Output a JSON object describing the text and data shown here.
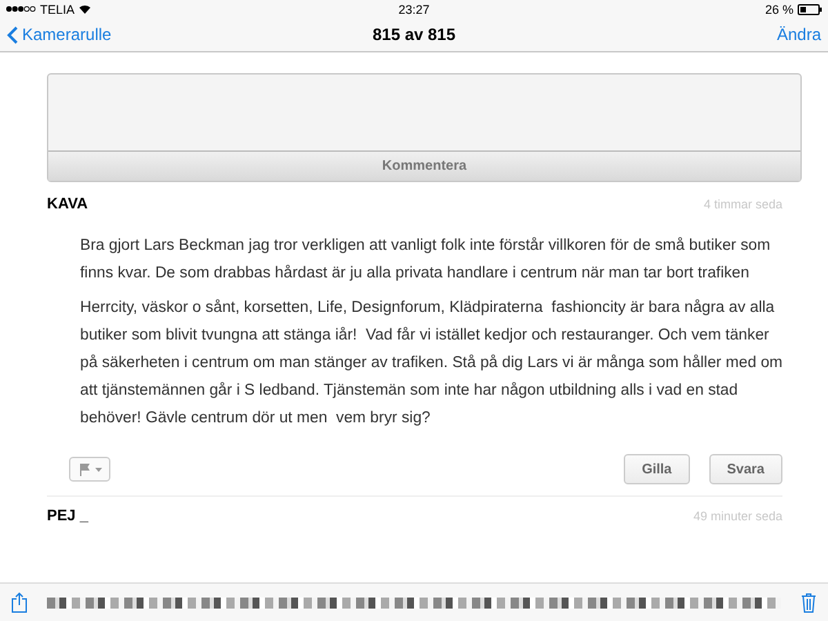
{
  "status_bar": {
    "carrier": "TELIA",
    "time": "23:27",
    "battery": "26 %"
  },
  "nav_bar": {
    "back": "Kamerarulle",
    "title": "815 av 815",
    "action": "Ändra"
  },
  "comment_box": {
    "button": "Kommentera"
  },
  "comments": [
    {
      "author": "KAVA",
      "time": "4 timmar seda",
      "paragraphs": [
        "Bra gjort Lars Beckman jag tror verkligen att vanligt folk inte förstår villkoren för de små butiker som finns kvar. De som drabbas hårdast är ju alla privata handlare i centrum när man tar bort trafiken",
        "Herrcity, väskor o sånt, korsetten, Life, Designforum, Klädpiraterna  fashioncity är bara några av alla butiker som blivit tvungna att stänga iår!  Vad får vi istället kedjor och restauranger. Och vem tänker på säkerheten i centrum om man stänger av trafiken. Stå på dig Lars vi är många som håller med om att tjänstemännen går i S ledband. Tjänstemän som inte har någon utbildning alls i vad en stad behöver! Gävle centrum dör ut men  vem bryr sig?"
      ],
      "buttons": [
        "Gilla",
        "Svara"
      ]
    },
    {
      "author": "PEJ _",
      "time": "49 minuter seda"
    }
  ]
}
